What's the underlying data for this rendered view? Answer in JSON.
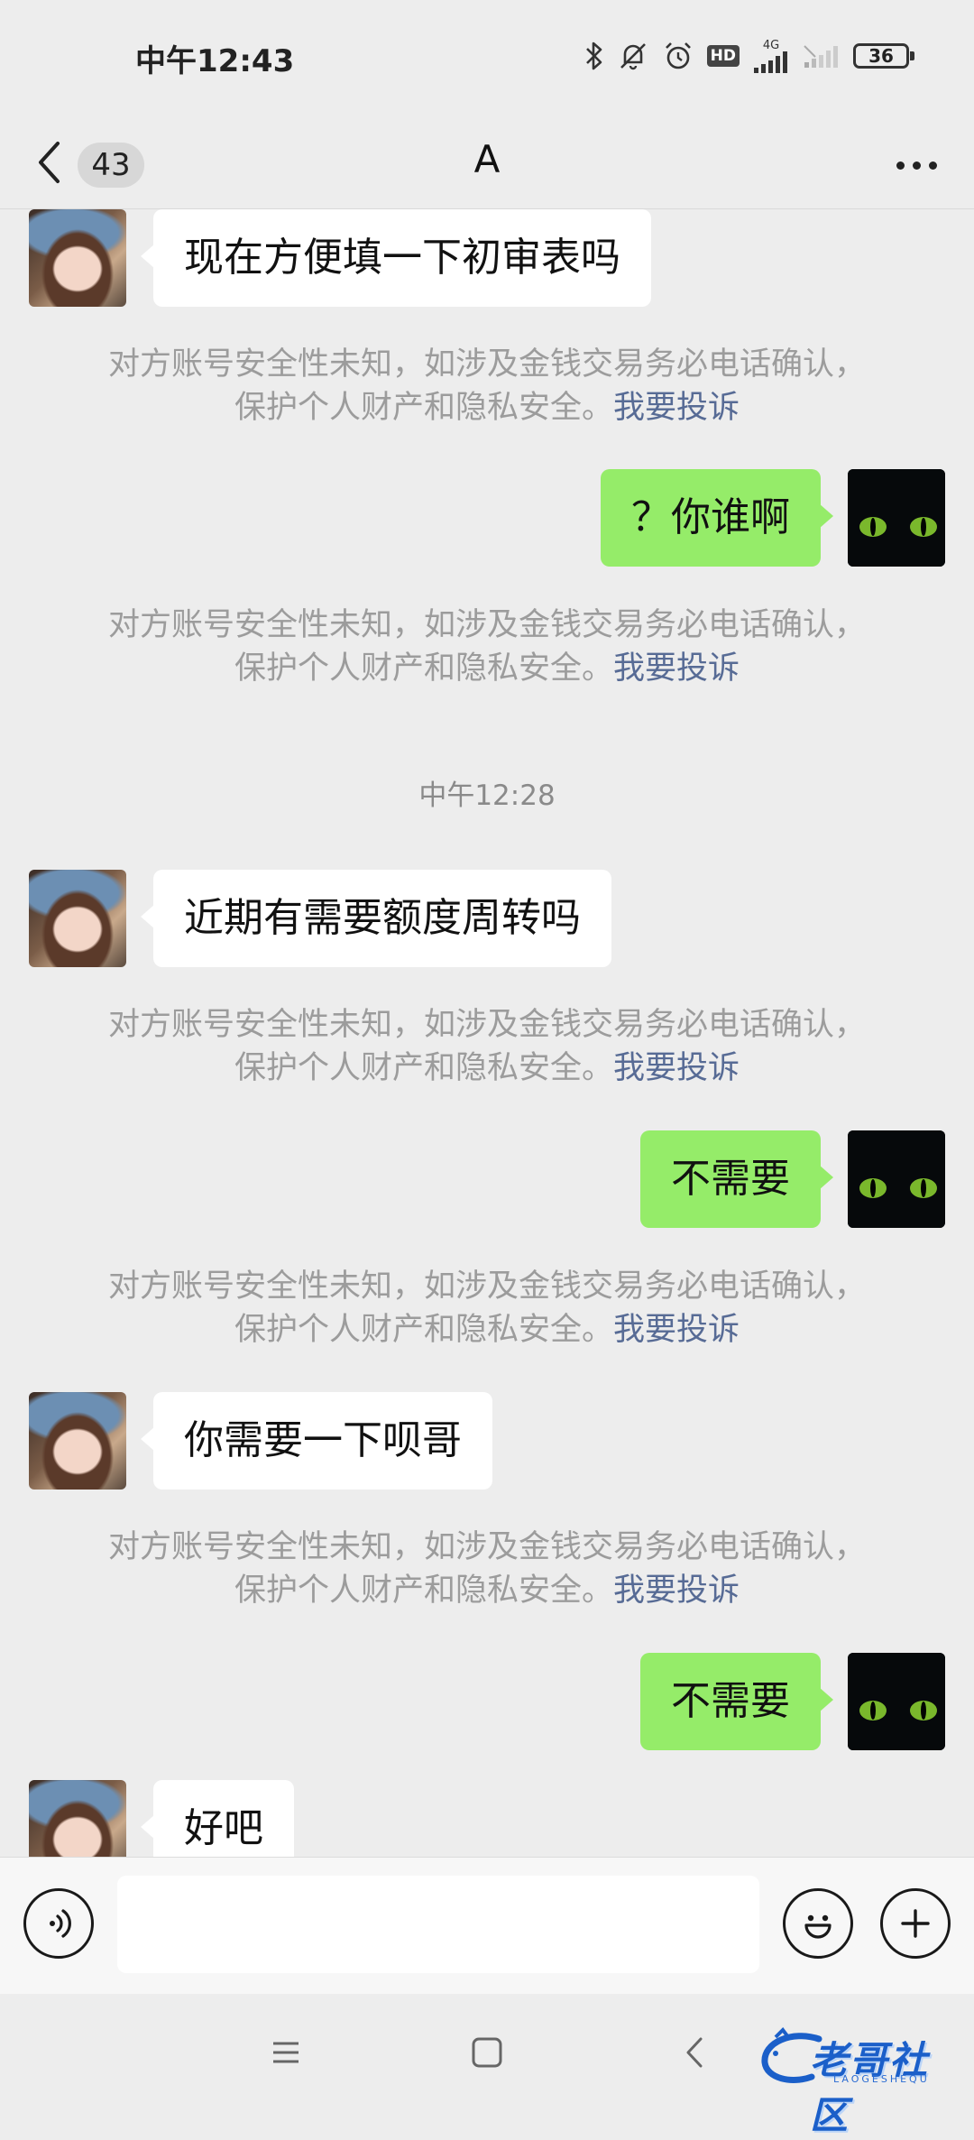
{
  "status_bar": {
    "time": "中午12:43",
    "network_label": "4G",
    "hd_label": "HD",
    "battery_level": "36"
  },
  "header": {
    "unread_count": "43",
    "title": "A"
  },
  "messages": [
    {
      "side": "left",
      "text": "现在方便填一下初审表吗"
    },
    {
      "side": "right",
      "text": "？你谁啊"
    },
    {
      "side": "left",
      "text": "近期有需要额度周转吗"
    },
    {
      "side": "right",
      "text": "不需要"
    },
    {
      "side": "left",
      "text": "你需要一下呗哥"
    },
    {
      "side": "right",
      "text": "不需要"
    },
    {
      "side": "left",
      "text": "好吧"
    }
  ],
  "security_notice": {
    "line1": "对方账号安全性未知，如涉及金钱交易务必电话确认，",
    "line2": "保护个人财产和隐私安全。",
    "link": "我要投诉"
  },
  "time_divider": "中午12:28",
  "input": {
    "value": "",
    "placeholder": ""
  },
  "watermark": {
    "text": "老哥社区",
    "sub": "LAOGESHEQU"
  },
  "colors": {
    "sent_bubble": "#95ec69",
    "received_bubble": "#ffffff",
    "link": "#576b95",
    "background": "#ededed"
  }
}
